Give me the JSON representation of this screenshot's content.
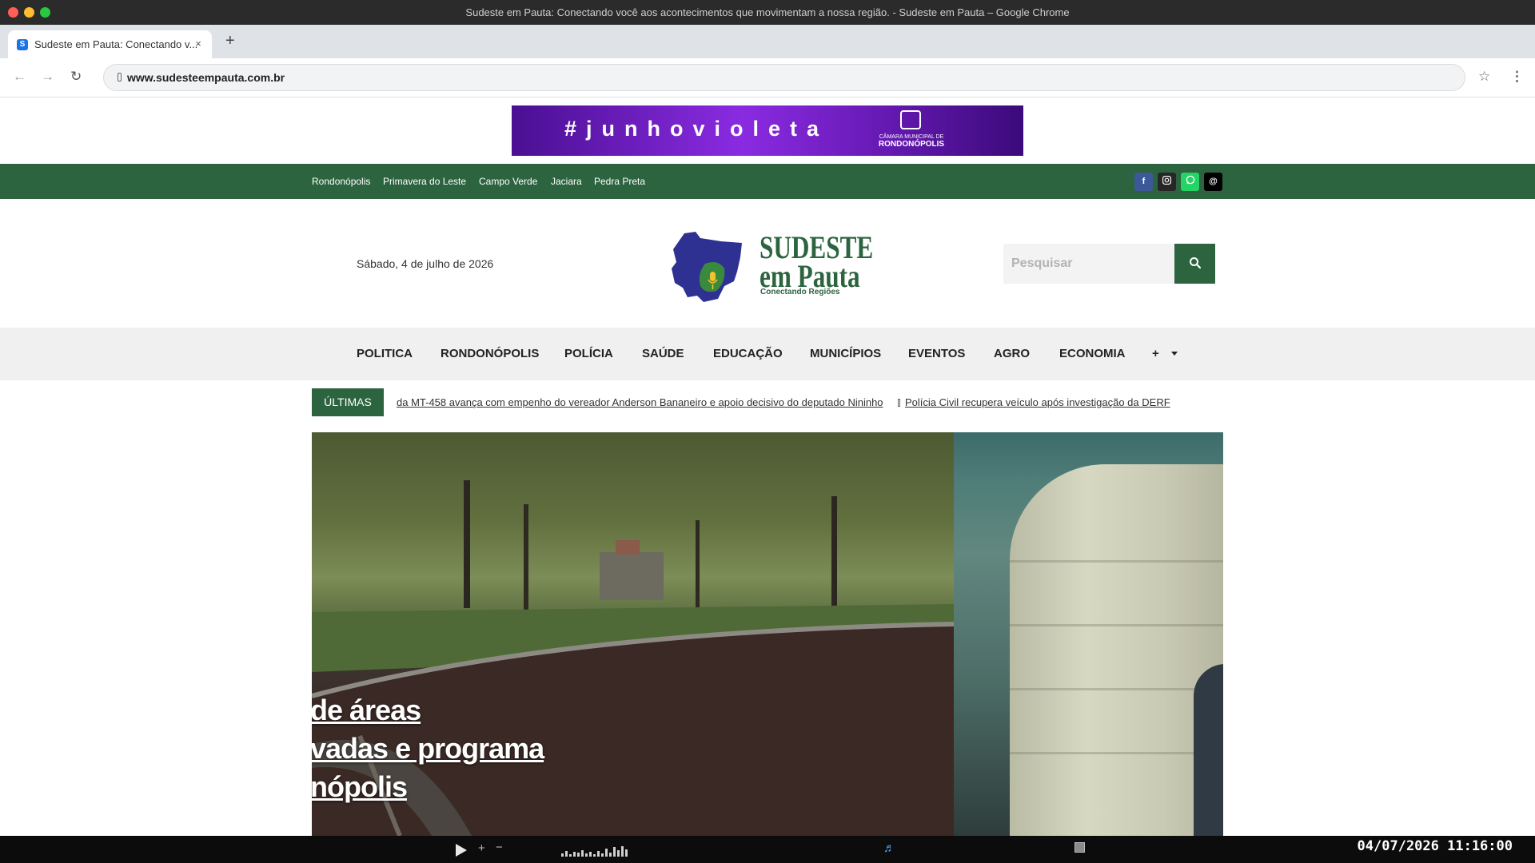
{
  "window": {
    "title": "Sudeste em Pauta: Conectando você aos acontecimentos que movimentam a nossa região. - Sudeste em Pauta – Google Chrome"
  },
  "browser": {
    "tab_title": "Sudeste em Pauta: Conectando v...",
    "tab_favicon": "S",
    "tab_close": "×",
    "new_tab": "+",
    "url": "www.sudesteempauta.com.br"
  },
  "ad_banner": {
    "text": "#junhovioleta",
    "org_small": "CÂMARA MUNICIPAL DE",
    "org": "RONDONÓPOLIS"
  },
  "city_links": [
    "Rondonópolis",
    "Primavera do Leste",
    "Campo Verde",
    "Jaciara",
    "Pedra Preta"
  ],
  "social_icons": [
    {
      "name": "facebook-icon",
      "color": "#3b5998"
    },
    {
      "name": "instagram-icon",
      "color": "#262626"
    },
    {
      "name": "whatsapp-icon",
      "color": "#25d366"
    },
    {
      "name": "threads-icon",
      "color": "#000000"
    }
  ],
  "header": {
    "date": "Sábado, 4 de julho de 2026",
    "logo_line1": "SUDESTE",
    "logo_line2": "em Pauta",
    "logo_tagline": "Conectando Regiões",
    "search_placeholder": "Pesquisar"
  },
  "nav": {
    "items": [
      "POLITICA",
      "RONDONÓPOLIS",
      "POLÍCIA",
      "SAÚDE",
      "EDUCAÇÃO",
      "MUNICÍPIOS",
      "EVENTOS",
      "AGRO",
      "ECONOMIA",
      "+"
    ]
  },
  "ticker": {
    "label": "ÚLTIMAS",
    "items": [
      "da MT-458 avança com empenho do vereador Anderson Bananeiro e apoio decisivo do deputado Nininho",
      "Polícia Civil recupera veículo após investigação da DERF"
    ]
  },
  "hero": {
    "title_lines": [
      "de áreas",
      "vadas e programa",
      "nópolis"
    ]
  },
  "system": {
    "clock": "04/07/2026 11:16:00"
  },
  "colors": {
    "brand_green": "#2d6440",
    "ad_purple": "#8a2be2"
  }
}
